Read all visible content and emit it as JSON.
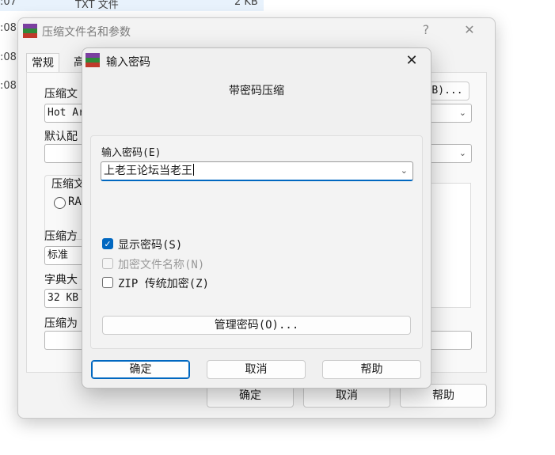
{
  "background": {
    "rows": [
      ":07",
      ":08",
      ":08",
      ":08"
    ],
    "file_type": "TXT 文件",
    "file_size": "2 KB"
  },
  "back_window": {
    "title": "压缩文件名和参数",
    "help_symbol": "?",
    "close_symbol": "✕",
    "tabs": [
      "常规",
      "高"
    ],
    "archive_name_label": "压缩文",
    "archive_name_value": "Hot Ar",
    "browse_label": "B)...",
    "profile_label": "默认配",
    "format_label": "压缩文",
    "format_option": "RA",
    "method_label": "压缩方",
    "method_value": "标准",
    "dict_label": "字典大",
    "dict_value": "32 KB",
    "split_label": "压缩为",
    "buttons": {
      "ok": "确定",
      "cancel": "取消",
      "help": "帮助"
    }
  },
  "dialog": {
    "title": "输入密码",
    "close_symbol": "✕",
    "heading": "带密码压缩",
    "password_label": "输入密码(E)",
    "password_value": "上老王论坛当老王",
    "show_password": {
      "label": "显示密码(S)",
      "checked": true
    },
    "encrypt_names": {
      "label": "加密文件名称(N)",
      "checked": false,
      "disabled": true
    },
    "zip_legacy": {
      "label": "ZIP 传统加密(Z)",
      "checked": false
    },
    "manage_button": "管理密码(O)...",
    "buttons": {
      "ok": "确定",
      "cancel": "取消",
      "help": "帮助"
    },
    "accent_color": "#0067c0"
  }
}
